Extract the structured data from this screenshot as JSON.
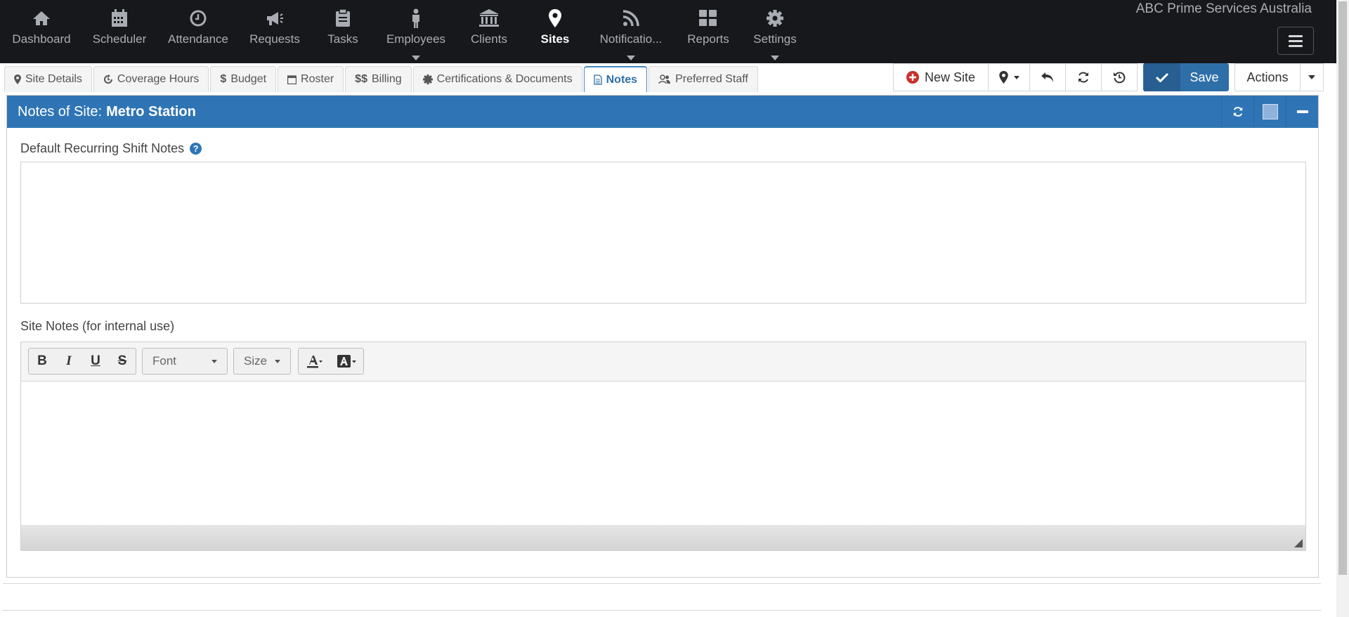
{
  "company": "ABC Prime Services Australia",
  "nav": {
    "items": [
      {
        "label": "Dashboard",
        "icon": "home-icon"
      },
      {
        "label": "Scheduler",
        "icon": "calendar-icon"
      },
      {
        "label": "Attendance",
        "icon": "clock-icon"
      },
      {
        "label": "Requests",
        "icon": "megaphone-icon"
      },
      {
        "label": "Tasks",
        "icon": "clipboard-icon"
      },
      {
        "label": "Employees",
        "icon": "person-icon"
      },
      {
        "label": "Clients",
        "icon": "bank-icon"
      },
      {
        "label": "Sites",
        "icon": "map-marker-icon"
      },
      {
        "label": "Notificatio...",
        "icon": "rss-icon"
      },
      {
        "label": "Reports",
        "icon": "grid-icon"
      },
      {
        "label": "Settings",
        "icon": "gear-icon"
      }
    ],
    "active": "Sites"
  },
  "tabs": [
    {
      "label": "Site Details"
    },
    {
      "label": "Coverage Hours"
    },
    {
      "label": "Budget"
    },
    {
      "label": "Roster"
    },
    {
      "label": "Billing"
    },
    {
      "label": "Certifications & Documents"
    },
    {
      "label": "Notes"
    },
    {
      "label": "Preferred Staff"
    }
  ],
  "toolbar": {
    "new_site": "New Site",
    "save": "Save",
    "actions": "Actions"
  },
  "panel": {
    "title_prefix": "Notes of Site:",
    "site_name": "Metro Station",
    "header_color": "#2f75b5"
  },
  "fields": {
    "recurring_label": "Default Recurring Shift Notes",
    "recurring_value": "",
    "site_notes_label": "Site Notes (for internal use)",
    "site_notes_value": ""
  },
  "editor": {
    "font_label": "Font",
    "size_label": "Size"
  }
}
